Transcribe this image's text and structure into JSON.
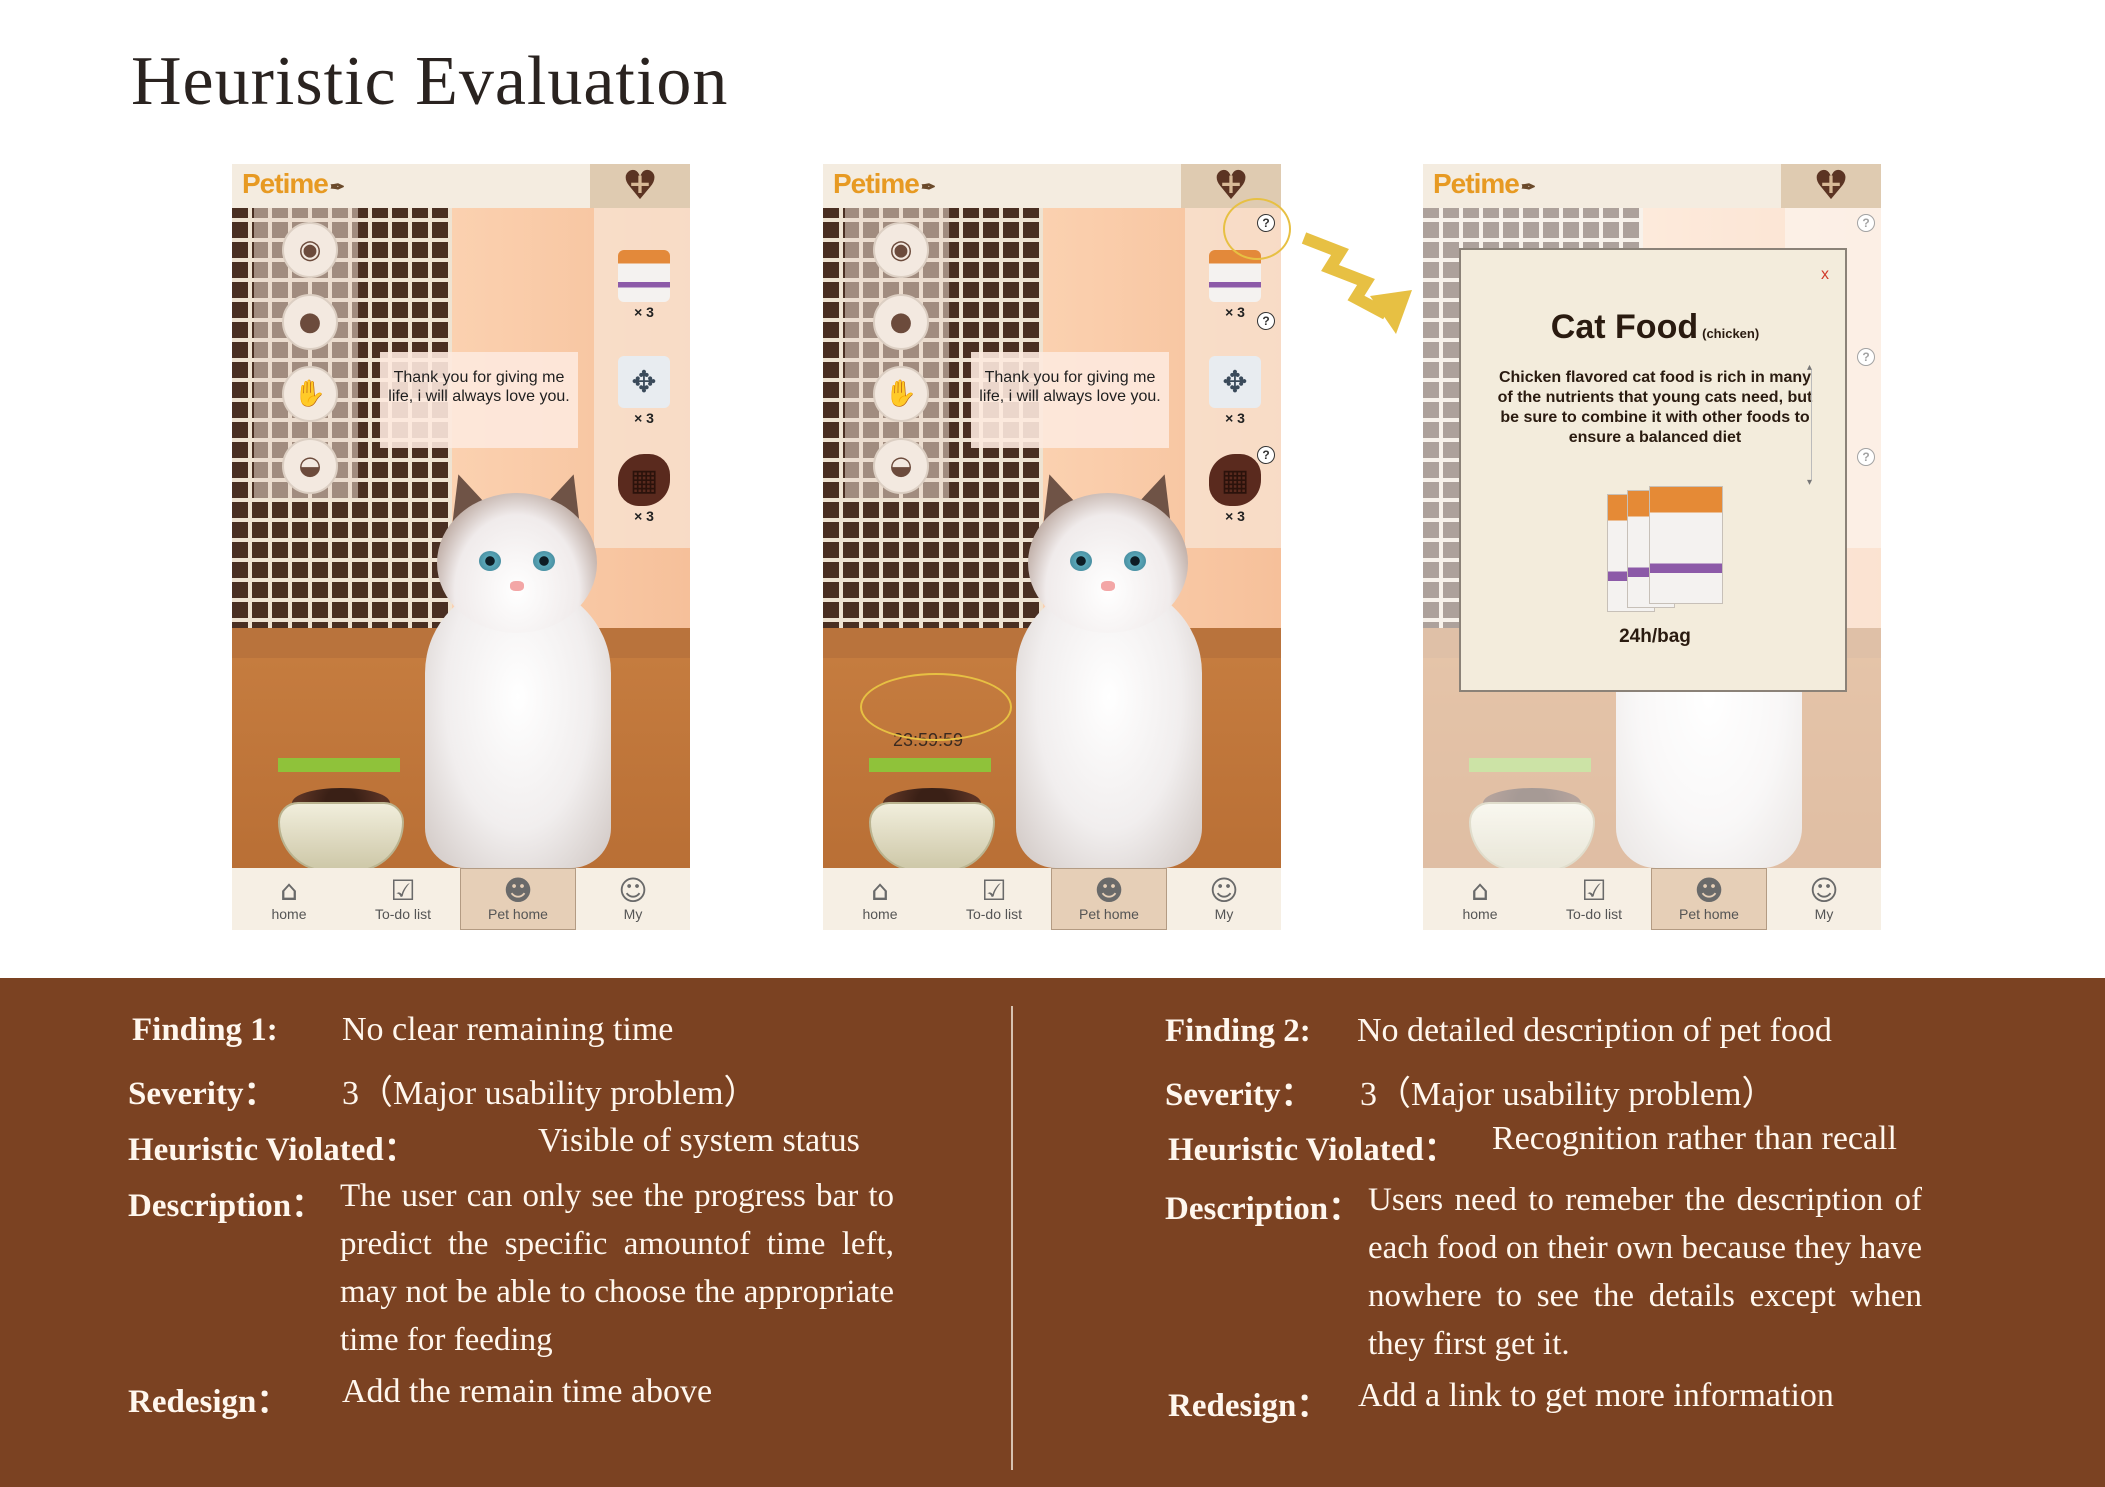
{
  "page": {
    "title": "Heuristic Evaluation"
  },
  "app": {
    "logo": "Petime",
    "tabs": [
      {
        "label": "home",
        "icon": "home-icon"
      },
      {
        "label": "To-do list",
        "icon": "checklist-icon"
      },
      {
        "label": "Pet home",
        "icon": "cat-face-icon"
      },
      {
        "label": "My",
        "icon": "user-icon"
      }
    ],
    "active_tab": "Pet home",
    "speech_bubble": "Thank you for giving me life, i will always love you.",
    "toys": [
      "ball-of-yarn-icon",
      "feather-toy-icon",
      "hand-icon",
      "toy-mouse-icon"
    ],
    "food": [
      {
        "name": "cat-food-bag",
        "qty": "× 3"
      },
      {
        "name": "fish",
        "qty": "× 3"
      },
      {
        "name": "steak",
        "qty": "× 3"
      }
    ],
    "timer": "23:59:59",
    "modal": {
      "close": "x",
      "title": "Cat Food",
      "subtitle": "(chicken)",
      "description": "Chicken flavored cat food is rich in many of the nutrients that young cats need, but be sure to combine it with other foods to ensure a balanced diet",
      "rate": "24h/bag"
    },
    "colors": {
      "accent_logo": "#e79a23",
      "progress": "#8fc23a",
      "annotation": "#e7c043",
      "findings_bg": "#7b4222"
    }
  },
  "findings": [
    {
      "finding_label": "Finding 1:",
      "finding": "No clear remaining time",
      "severity_label": "Severity：",
      "severity": "3（Major usability problem）",
      "heuristic_label": "Heuristic Violated：",
      "heuristic": "Visible of system status",
      "description_label": "Description：",
      "description": "The user can only see the progress bar to predict the specific amountof time left, may not be able to choose the appropriate time for feeding",
      "redesign_label": "Redesign：",
      "redesign": "Add the remain time above"
    },
    {
      "finding_label": "Finding 2:",
      "finding": "No detailed description of pet food",
      "severity_label": "Severity：",
      "severity": "3（Major usability problem）",
      "heuristic_label": "Heuristic Violated：",
      "heuristic": "Recognition rather than recall",
      "description_label": "Description：",
      "description": "Users need to remeber the description of each food on their own because they have nowhere to see the details except when they first get it.",
      "redesign_label": "Redesign：",
      "redesign": "Add a link to get more information"
    }
  ]
}
